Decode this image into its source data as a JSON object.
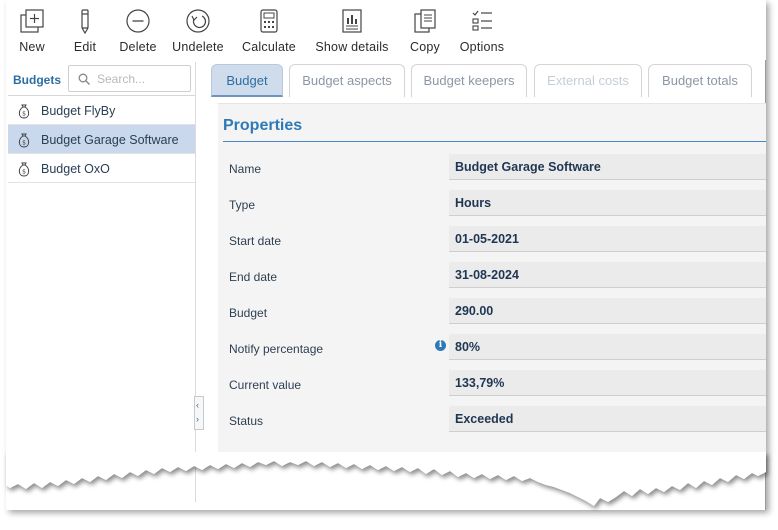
{
  "toolbar": {
    "new": "New",
    "edit": "Edit",
    "delete": "Delete",
    "undelete": "Undelete",
    "calculate": "Calculate",
    "show_details": "Show details",
    "copy": "Copy",
    "options": "Options"
  },
  "sidebar": {
    "title": "Budgets",
    "search_placeholder": "Search...",
    "items": [
      {
        "label": "Budget FlyBy",
        "icon": "money-bag-icon",
        "selected": false
      },
      {
        "label": "Budget Garage Software",
        "icon": "money-bag-icon",
        "selected": true
      },
      {
        "label": "Budget OxO",
        "icon": "money-bag-icon",
        "selected": false
      }
    ]
  },
  "tabs": [
    {
      "label": "Budget",
      "state": "active"
    },
    {
      "label": "Budget aspects",
      "state": "normal"
    },
    {
      "label": "Budget keepers",
      "state": "normal"
    },
    {
      "label": "External costs",
      "state": "disabled"
    },
    {
      "label": "Budget totals",
      "state": "normal"
    }
  ],
  "properties": {
    "title": "Properties",
    "rows": [
      {
        "label": "Name",
        "value": "Budget Garage Software"
      },
      {
        "label": "Type",
        "value": "Hours"
      },
      {
        "label": "Start date",
        "value": "01-05-2021"
      },
      {
        "label": "End date",
        "value": "31-08-2024"
      },
      {
        "label": "Budget",
        "value": "290.00"
      },
      {
        "label": "Notify percentage",
        "value": "80%"
      },
      {
        "label": "Current value",
        "value": "133,79%"
      },
      {
        "label": "Status",
        "value": "Exceeded"
      }
    ]
  },
  "colors": {
    "accent": "#2f79b8",
    "selected_row": "#c9d8ec",
    "active_tab": "#cfdcec"
  }
}
